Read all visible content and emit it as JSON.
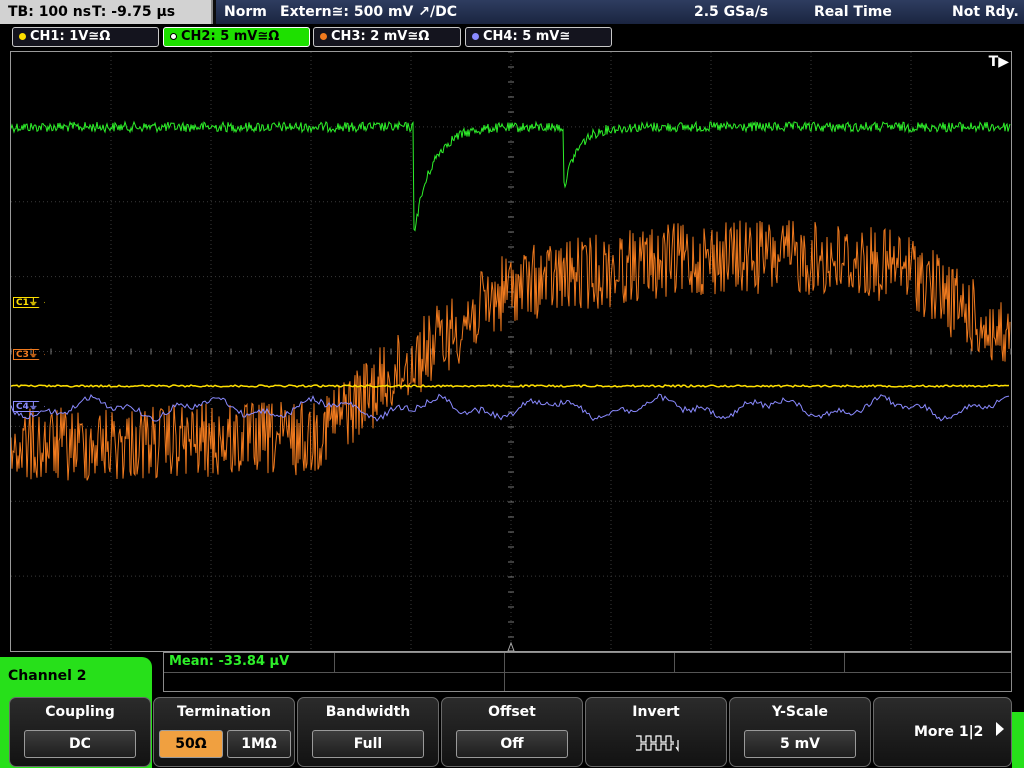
{
  "topbar": {
    "tb_label": "TB: 100 ns",
    "t_label": "T: -9.75 µs",
    "mode": "Norm",
    "trigger": "Extern≅: 500 mV ↗/DC",
    "sample_rate": "2.5 GSa/s",
    "acq_mode": "Real Time",
    "status": "Not Rdy."
  },
  "channels": [
    {
      "label": "CH1: 1V≅Ω",
      "color": "#ffe000"
    },
    {
      "label": "CH2: 5 mV≅Ω",
      "color": "#2ef02a"
    },
    {
      "label": "CH3: 2 mV≅Ω",
      "color": "#f07a1e"
    },
    {
      "label": "CH4: 5 mV≅",
      "color": "#8a8aff"
    }
  ],
  "markers": {
    "trigger": "T▶",
    "c1": "C1⏚",
    "c3": "C3⏚",
    "c4": "C4⏚"
  },
  "measurement": {
    "mean": "Mean: -33.84 µV"
  },
  "menu": {
    "title": "Channel 2",
    "coupling": {
      "title": "Coupling",
      "value": "DC"
    },
    "termination": {
      "title": "Termination",
      "opt1": "50Ω",
      "opt2": "1MΩ"
    },
    "bandwidth": {
      "title": "Bandwidth",
      "value": "Full"
    },
    "offset": {
      "title": "Offset",
      "value": "Off"
    },
    "invert": {
      "title": "Invert"
    },
    "yscale": {
      "title": "Y-Scale",
      "value": "5 mV"
    },
    "more": {
      "label": "More 1|2"
    }
  }
}
